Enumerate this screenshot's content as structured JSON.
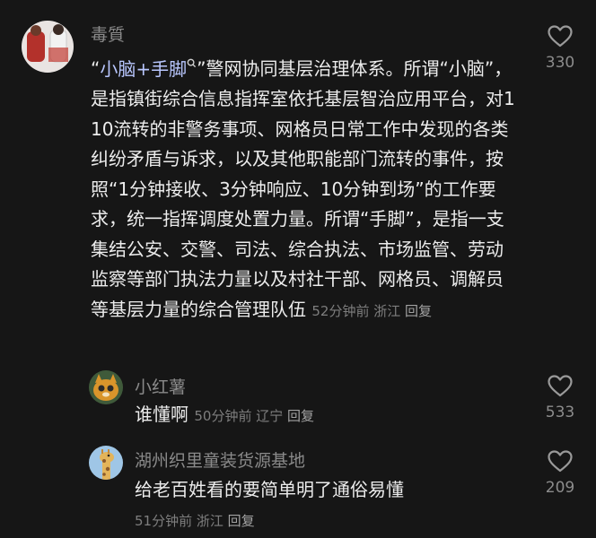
{
  "comments": [
    {
      "username": "毒質",
      "avatar": "avatar-figures",
      "content_parts": {
        "open_quote": "“",
        "link_text": "小脑+手脚",
        "link_icon": "search-icon",
        "rest": "”警网协同基层治理体系。所谓“小脑”，是指镇街综合信息指挥室依托基层智治应用平台，对110流转的非警务事项、网格员日常工作中发现的各类纠纷矛盾与诉求，以及其他职能部门流转的事件，按照“1分钟接收、3分钟响应、10分钟到场”的工作要求，统一指挥调度处置力量。所谓“手脚”，是指一支集结公安、交警、司法、综合执法、市场监管、劳动监察等部门执法力量以及村社干部、网格员、调解员等基层力量的综合管理队伍"
      },
      "time": "52分钟前",
      "location": "浙江",
      "reply_label": "回复",
      "likes": "330"
    },
    {
      "username": "小红薯",
      "avatar": "avatar-cat",
      "content": "谁懂啊",
      "time": "50分钟前",
      "location": "辽宁",
      "reply_label": "回复",
      "likes": "533"
    },
    {
      "username": "湖州织里童装货源基地",
      "avatar": "avatar-giraffe",
      "content": "给老百姓看的要简单明了通俗易懂",
      "time": "51分钟前",
      "location": "浙江",
      "reply_label": "回复",
      "likes": "209"
    }
  ]
}
